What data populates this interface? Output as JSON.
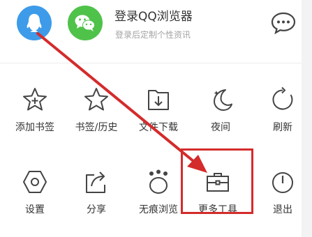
{
  "header": {
    "login_title": "登录QQ浏览器",
    "login_subtitle": "登录后定制个性资讯",
    "qq_avatar_icon": "qq-penguin-icon",
    "wechat_avatar_icon": "wechat-icon",
    "message_icon": "chat-bubble-icon"
  },
  "menu": {
    "rows": [
      [
        {
          "label": "添加书签",
          "icon": "star-plus-icon"
        },
        {
          "label": "书签/历史",
          "icon": "star-icon"
        },
        {
          "label": "文件下载",
          "icon": "download-folder-icon"
        },
        {
          "label": "夜间",
          "icon": "moon-icon"
        },
        {
          "label": "刷新",
          "icon": "refresh-icon"
        }
      ],
      [
        {
          "label": "设置",
          "icon": "hexagon-gear-icon"
        },
        {
          "label": "分享",
          "icon": "share-icon"
        },
        {
          "label": "无痕浏览",
          "icon": "paw-icon"
        },
        {
          "label": "更多工具",
          "icon": "toolbox-icon"
        },
        {
          "label": "退出",
          "icon": "power-icon"
        }
      ]
    ]
  },
  "colors": {
    "qq_blue": "#3d9be9",
    "wechat_green": "#4fc24a",
    "annotation_red": "#d42b2b",
    "text": "#333333",
    "subtext": "#a3a3a3"
  }
}
